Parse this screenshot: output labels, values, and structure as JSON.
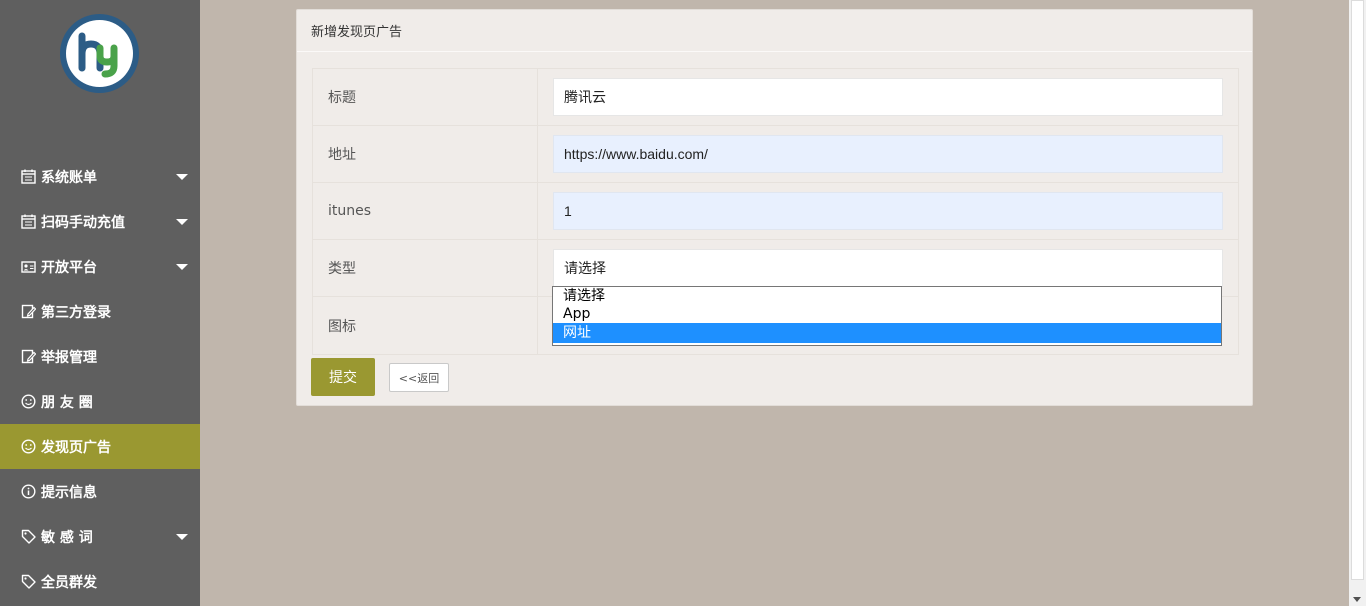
{
  "sidebar": {
    "logo_text": "hy",
    "items": [
      {
        "label": "系统账单",
        "icon": "calendar-icon",
        "has_caret": true
      },
      {
        "label": "扫码手动充值",
        "icon": "calendar-icon",
        "has_caret": true
      },
      {
        "label": "开放平台",
        "icon": "id-card-icon",
        "has_caret": true
      },
      {
        "label": "第三方登录",
        "icon": "edit-icon",
        "has_caret": false
      },
      {
        "label": "举报管理",
        "icon": "edit-icon",
        "has_caret": false
      },
      {
        "label": "朋 友 圈",
        "icon": "smile-icon",
        "has_caret": false
      },
      {
        "label": "发现页广告",
        "icon": "smile-icon",
        "has_caret": false,
        "active": true
      },
      {
        "label": "提示信息",
        "icon": "info-icon",
        "has_caret": false
      },
      {
        "label": "敏 感 词",
        "icon": "tag-icon",
        "has_caret": true
      },
      {
        "label": "全员群发",
        "icon": "tag-icon",
        "has_caret": false
      }
    ]
  },
  "panel": {
    "title": "新增发现页广告"
  },
  "form": {
    "title_label": "标题",
    "title_value": "腾讯云",
    "url_label": "地址",
    "url_value": "https://www.baidu.com/",
    "itunes_label": "itunes",
    "itunes_value": "1",
    "type_label": "类型",
    "type_value": "请选择",
    "icon_label": "图标",
    "type_options": [
      "请选择",
      "App",
      "网址"
    ],
    "type_highlighted": "网址"
  },
  "buttons": {
    "submit": "提交",
    "back": "<<返回"
  },
  "colors": {
    "sidebar_bg": "#5f5f5f",
    "accent": "#9a9831",
    "page_bg": "#c0b6ac",
    "panel_bg": "#f0ece9",
    "highlight": "#1e90ff"
  }
}
